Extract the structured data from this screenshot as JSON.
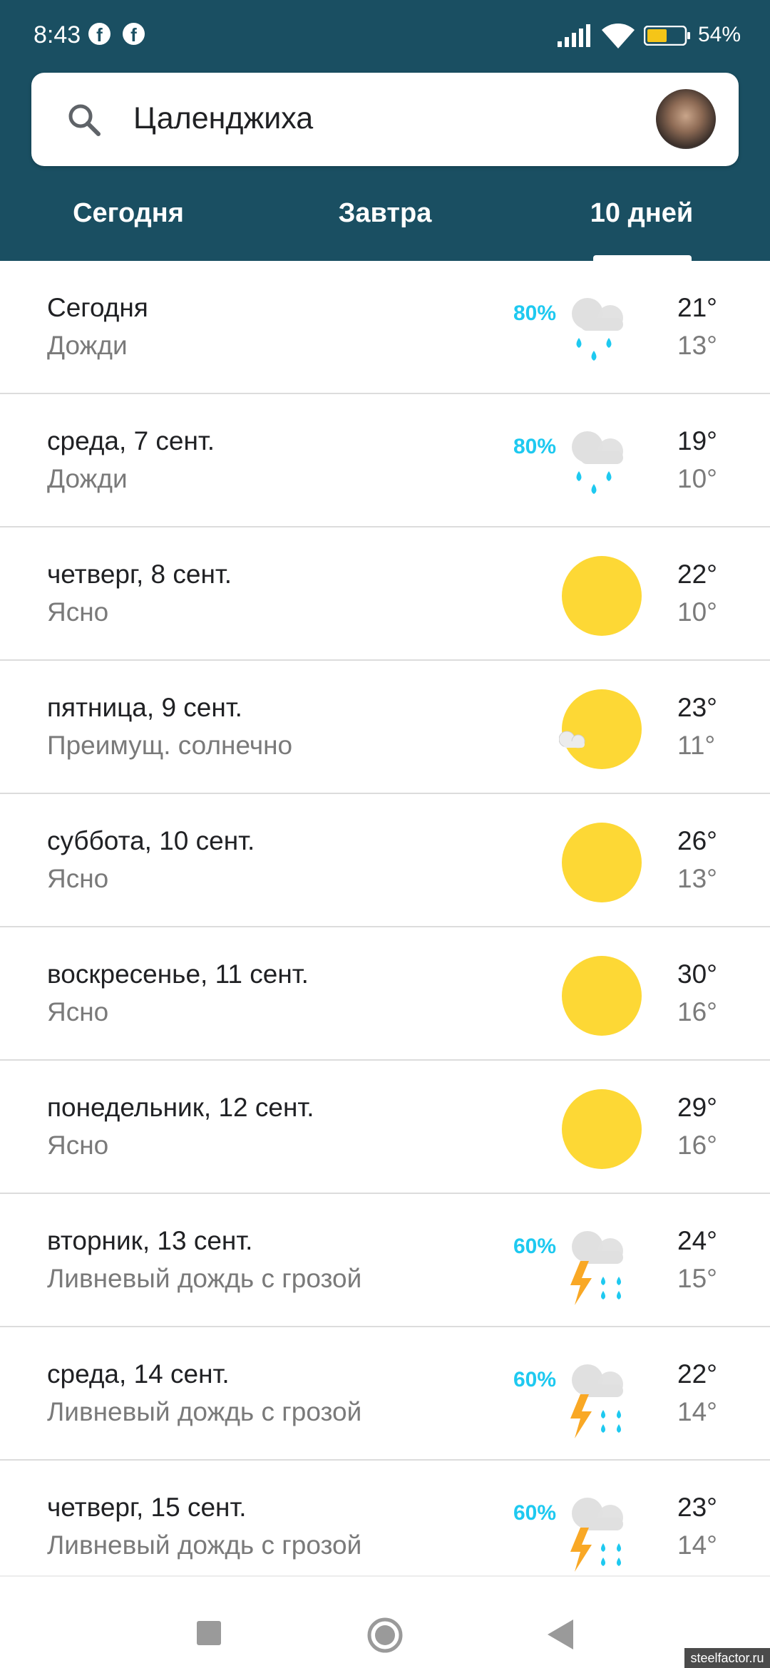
{
  "status_bar": {
    "time": "8:43",
    "notif_icons": [
      "facebook-icon",
      "facebook-icon"
    ],
    "battery_percent": "54%",
    "battery_level": 0.54
  },
  "search": {
    "location": "Цаленджиха",
    "icon": "search-icon"
  },
  "tabs": [
    {
      "label": "Сегодня"
    },
    {
      "label": "Завтра"
    },
    {
      "label": "10 дней",
      "selected": true
    }
  ],
  "forecast": [
    {
      "day": "Сегодня",
      "condition": "Дожди",
      "precip": "80%",
      "icon": "rain",
      "high": "21°",
      "low": "13°"
    },
    {
      "day": "среда, 7 сент.",
      "condition": "Дожди",
      "precip": "80%",
      "icon": "rain",
      "high": "19°",
      "low": "10°"
    },
    {
      "day": "четверг, 8 сент.",
      "condition": "Ясно",
      "precip": "",
      "icon": "sun",
      "high": "22°",
      "low": "10°"
    },
    {
      "day": "пятница, 9 сент.",
      "condition": "Преимущ. солнечно",
      "precip": "",
      "icon": "mostly-sunny",
      "high": "23°",
      "low": "11°"
    },
    {
      "day": "суббота, 10 сент.",
      "condition": "Ясно",
      "precip": "",
      "icon": "sun",
      "high": "26°",
      "low": "13°"
    },
    {
      "day": "воскресенье, 11 сент.",
      "condition": "Ясно",
      "precip": "",
      "icon": "sun",
      "high": "30°",
      "low": "16°"
    },
    {
      "day": "понедельник, 12 сент.",
      "condition": "Ясно",
      "precip": "",
      "icon": "sun",
      "high": "29°",
      "low": "16°"
    },
    {
      "day": "вторник, 13 сент.",
      "condition": "Ливневый дождь с грозой",
      "precip": "60%",
      "icon": "thunderstorm",
      "high": "24°",
      "low": "15°"
    },
    {
      "day": "среда, 14 сент.",
      "condition": "Ливневый дождь с грозой",
      "precip": "60%",
      "icon": "thunderstorm",
      "high": "22°",
      "low": "14°"
    },
    {
      "day": "четверг, 15 сент.",
      "condition": "Ливневый дождь с грозой",
      "precip": "60%",
      "icon": "thunderstorm",
      "high": "23°",
      "low": "14°"
    }
  ],
  "watermark": "steelfactor.ru",
  "colors": {
    "header": "#1a4f62",
    "precip": "#1ec9f0",
    "sun": "#fdd835",
    "cloud": "#e0e0e0",
    "bolt": "#f9a825"
  }
}
